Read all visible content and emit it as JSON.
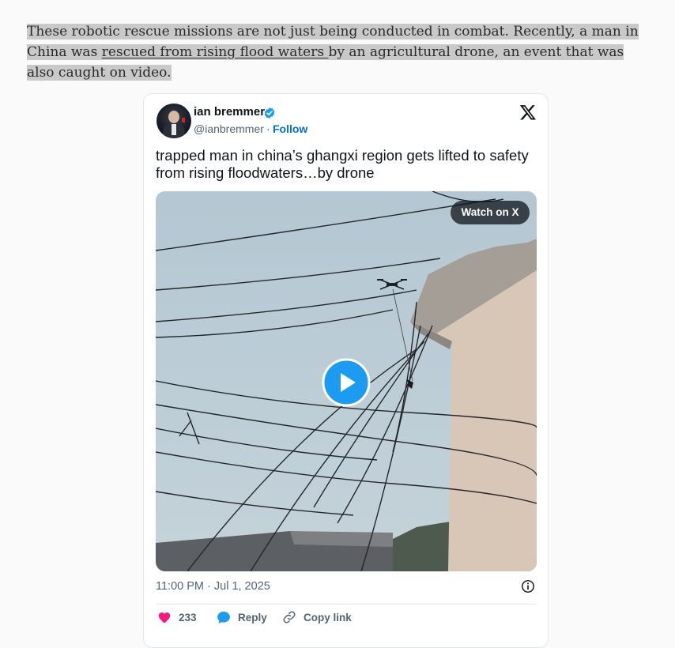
{
  "article": {
    "text_before_link": "These robotic rescue missions are not just being conducted in combat. Recently, a man in China was ",
    "link_text": "rescued from rising flood waters ",
    "text_after_link": "by an agricultural drone, an event that was also caught on video."
  },
  "tweet": {
    "author_name": "ian bremmer",
    "handle": "@ianbremmer",
    "separator": "·",
    "follow_label": "Follow",
    "text": "trapped man in china’s ghangxi region gets lifted to safety from rising floodwaters…by drone",
    "media": {
      "watch_label": "Watch on X"
    },
    "timestamp": "11:00 PM · Jul 1, 2025",
    "actions": {
      "like_count": "233",
      "reply_label": "Reply",
      "copy_label": "Copy link"
    },
    "icons": [
      "verified-icon",
      "x-logo-icon",
      "play-icon",
      "info-icon",
      "heart-icon",
      "reply-icon",
      "link-icon"
    ],
    "colors": {
      "follow": "#006fd6",
      "verified": "#1d9bf0",
      "like": "#f91880",
      "play": "#1d9bf0"
    }
  }
}
